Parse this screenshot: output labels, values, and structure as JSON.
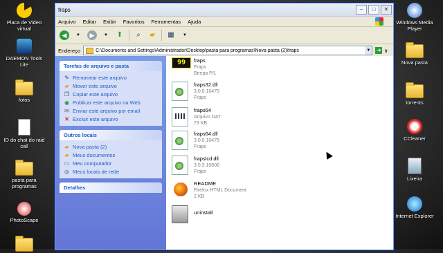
{
  "desktop_left": [
    {
      "label": "Placa de Video virtual",
      "icon": "pacman-icon"
    },
    {
      "label": "DAEMON Tools Lite",
      "icon": "daemon-tools-icon"
    },
    {
      "label": "fotos",
      "icon": "folder-icon"
    },
    {
      "label": "ID do chat do raid call",
      "icon": "text-document-icon"
    },
    {
      "label": "pasta para programas",
      "icon": "folder-icon"
    },
    {
      "label": "PhotoScape",
      "icon": "photoscape-icon"
    }
  ],
  "desktop_right": [
    {
      "label": "Windows Media Player",
      "icon": "media-player-icon"
    },
    {
      "label": "Nova pasta",
      "icon": "folder-icon"
    },
    {
      "label": "torrents",
      "icon": "folder-icon"
    },
    {
      "label": "CCleaner",
      "icon": "ccleaner-icon"
    },
    {
      "label": "Lixeira",
      "icon": "recycle-bin-icon"
    },
    {
      "label": "Internet Explorer",
      "icon": "ie-icon"
    }
  ],
  "window": {
    "title": "fraps",
    "menu": [
      "Arquivo",
      "Editar",
      "Exibir",
      "Favoritos",
      "Ferramentas",
      "Ajuda"
    ],
    "address_label": "Endereço",
    "address_value": "C:\\Documents and Settings\\Administrador\\Desktop\\pasta para programas\\Nova pasta (2)\\fraps",
    "go_label": "Ir"
  },
  "tasks": {
    "heading": "Tarefas de arquivo e pasta",
    "items": [
      "Renomear este arquivo",
      "Mover este arquivo",
      "Copiar este arquivo",
      "Publicar este arquivo na Web",
      "Enviar este arquivo por email",
      "Excluir este arquivo"
    ]
  },
  "other_places": {
    "heading": "Outros locais",
    "items": [
      "Nova pasta (2)",
      "Meus documentos",
      "Meu computador",
      "Meus locais de rede"
    ]
  },
  "details": {
    "heading": "Detalhes"
  },
  "files": [
    {
      "name": "fraps",
      "lines": [
        "Fraps",
        "Beepa P/L"
      ],
      "icon": "fraps-exe-icon"
    },
    {
      "name": "fraps32.dll",
      "lines": [
        "3.0.0.10475",
        "Fraps"
      ],
      "icon": "dll-icon"
    },
    {
      "name": "fraps64",
      "lines": [
        "Arquivo DAT",
        "73 KB"
      ],
      "icon": "dat-file-icon"
    },
    {
      "name": "fraps64.dll",
      "lines": [
        "3.0.0.10475",
        "Fraps"
      ],
      "icon": "dll-icon"
    },
    {
      "name": "frapslcd.dll",
      "lines": [
        "3.0.3.10808",
        "Fraps"
      ],
      "icon": "dll-icon"
    },
    {
      "name": "README",
      "lines": [
        "Firefox HTML Document",
        "2 KB"
      ],
      "icon": "firefox-document-icon"
    },
    {
      "name": "uninstall",
      "lines": [],
      "icon": "uninstall-icon"
    }
  ],
  "fraps_icon_text": "99"
}
